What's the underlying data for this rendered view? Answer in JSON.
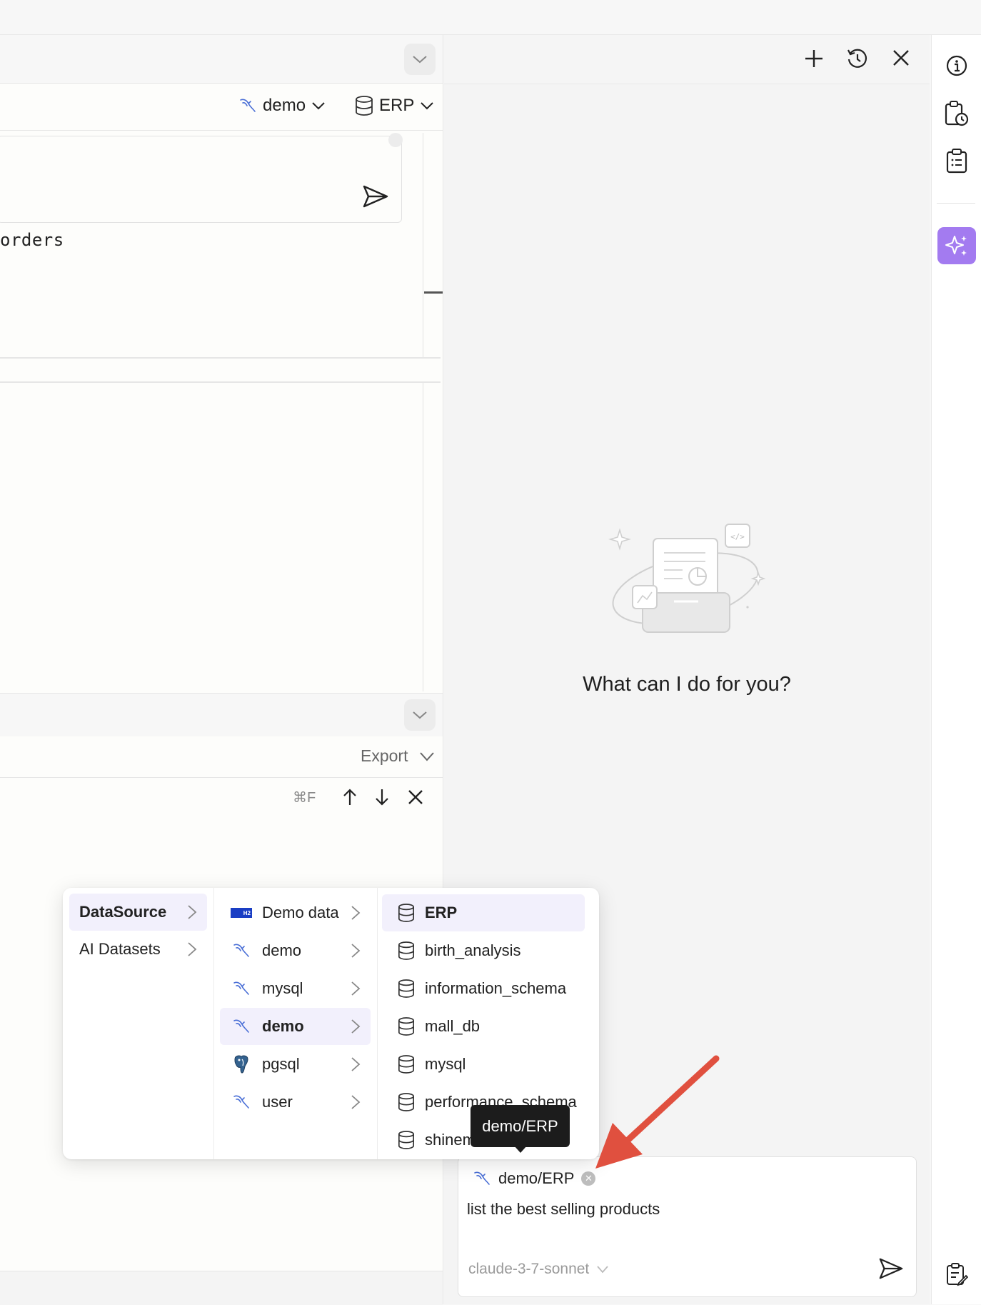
{
  "editor": {
    "datasource_label": "demo",
    "database_label": "ERP",
    "code_text": "orders"
  },
  "results": {
    "export_label": "Export",
    "search_shortcut": "⌘F"
  },
  "assistant": {
    "empty_prompt": "What can I do for you?",
    "context_chip": "demo/ERP",
    "input_text": "list the best selling products",
    "model": "claude-3-7-sonnet"
  },
  "dropdown": {
    "column1": [
      {
        "label": "DataSource",
        "active": true
      },
      {
        "label": "AI Datasets",
        "active": false
      }
    ],
    "column2": [
      {
        "label": "Demo data",
        "icon": "h2-icon",
        "active": false
      },
      {
        "label": "demo",
        "icon": "mysql-icon",
        "active": false
      },
      {
        "label": "mysql",
        "icon": "mysql-icon",
        "active": false
      },
      {
        "label": "demo",
        "icon": "mysql-icon",
        "active": true
      },
      {
        "label": "pgsql",
        "icon": "postgres-icon",
        "active": false
      },
      {
        "label": "user",
        "icon": "mysql-icon",
        "active": false
      }
    ],
    "column3": [
      {
        "label": "ERP",
        "active": true
      },
      {
        "label": "birth_analysis",
        "active": false
      },
      {
        "label": "information_schema",
        "active": false
      },
      {
        "label": "mall_db",
        "active": false
      },
      {
        "label": "mysql",
        "active": false
      },
      {
        "label": "performance_schema",
        "active": false
      },
      {
        "label": "shinemo",
        "active": false
      }
    ]
  },
  "tooltip": {
    "text": "demo/ERP"
  },
  "colors": {
    "accent": "#a37bf0",
    "arrow": "#e0503f",
    "active_row": "#f2f0fc"
  }
}
